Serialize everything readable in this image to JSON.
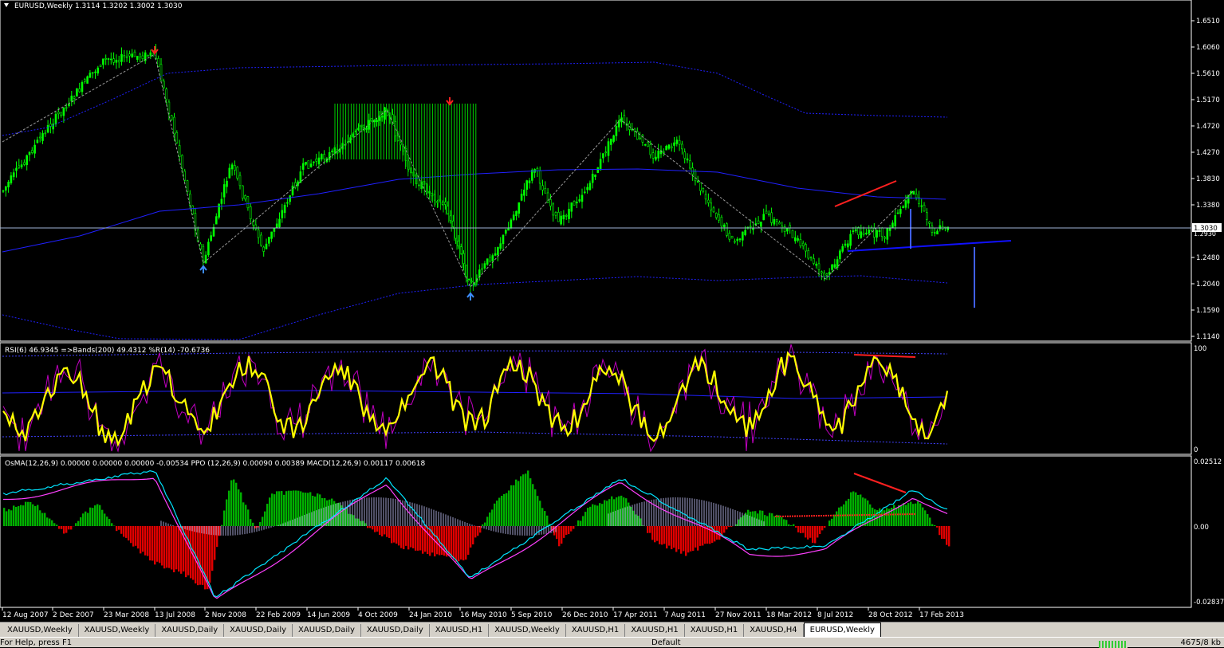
{
  "main_chart": {
    "header": "EURUSD,Weekly  1.3114 1.3202 1.3002 1.3030",
    "current_price": "1.3030",
    "hidden_price_label": "1.2930",
    "price_axis": [
      "1.6510",
      "1.6060",
      "1.5610",
      "1.5170",
      "1.4720",
      "1.4270",
      "1.3830",
      "1.3380",
      "1.2480",
      "1.2040",
      "1.1590",
      "1.1140"
    ]
  },
  "rsi_panel": {
    "header": "RSI(6) 46.9345  =>Bands(200) 49.4312  %R(14) -70.6736",
    "axis": [
      "100",
      "0"
    ]
  },
  "macd_panel": {
    "header": "OsMA(12,26,9) 0.00000 0.00000 0.00000 -0.00534  PPO (12,26,9) 0.00090 0.00389  MACD(12,26,9) 0.00117 0.00618",
    "axis": [
      "0.02512",
      "0.00",
      "-0.02837"
    ]
  },
  "time_axis": [
    "12 Aug 2007",
    "2 Dec 2007",
    "23 Mar 2008",
    "13 Jul 2008",
    "2 Nov 2008",
    "22 Feb 2009",
    "14 Jun 2009",
    "4 Oct 2009",
    "24 Jan 2010",
    "16 May 2010",
    "5 Sep 2010",
    "26 Dec 2010",
    "17 Apr 2011",
    "7 Aug 2011",
    "27 Nov 2011",
    "18 Mar 2012",
    "8 Jul 2012",
    "28 Oct 2012",
    "17 Feb 2013"
  ],
  "tabs": [
    {
      "label": "XAUUSD,Weekly"
    },
    {
      "label": "XAUUSD,Weekly"
    },
    {
      "label": "XAUUSD,Daily"
    },
    {
      "label": "XAUUSD,Daily"
    },
    {
      "label": "XAUUSD,Daily"
    },
    {
      "label": "XAUUSD,Daily"
    },
    {
      "label": "XAUUSD,H1"
    },
    {
      "label": "XAUUSD,Weekly"
    },
    {
      "label": "XAUUSD,H1"
    },
    {
      "label": "XAUUSD,H1"
    },
    {
      "label": "XAUUSD,H1"
    },
    {
      "label": "XAUUSD,H4"
    },
    {
      "label": "EURUSD,Weekly",
      "active": true
    }
  ],
  "status": {
    "help": "For Help, press F1",
    "profile": "Default",
    "traffic": "4675/8 kb"
  },
  "colors": {
    "candle": "#00ff00",
    "ma": "#0000ff",
    "rsi": "#ffff00",
    "wpr": "#c000c0",
    "hist_up": "#00c000",
    "hist_down": "#ff0000",
    "macd_fast": "#00e5ff",
    "macd_slow": "#ff40ff"
  }
}
